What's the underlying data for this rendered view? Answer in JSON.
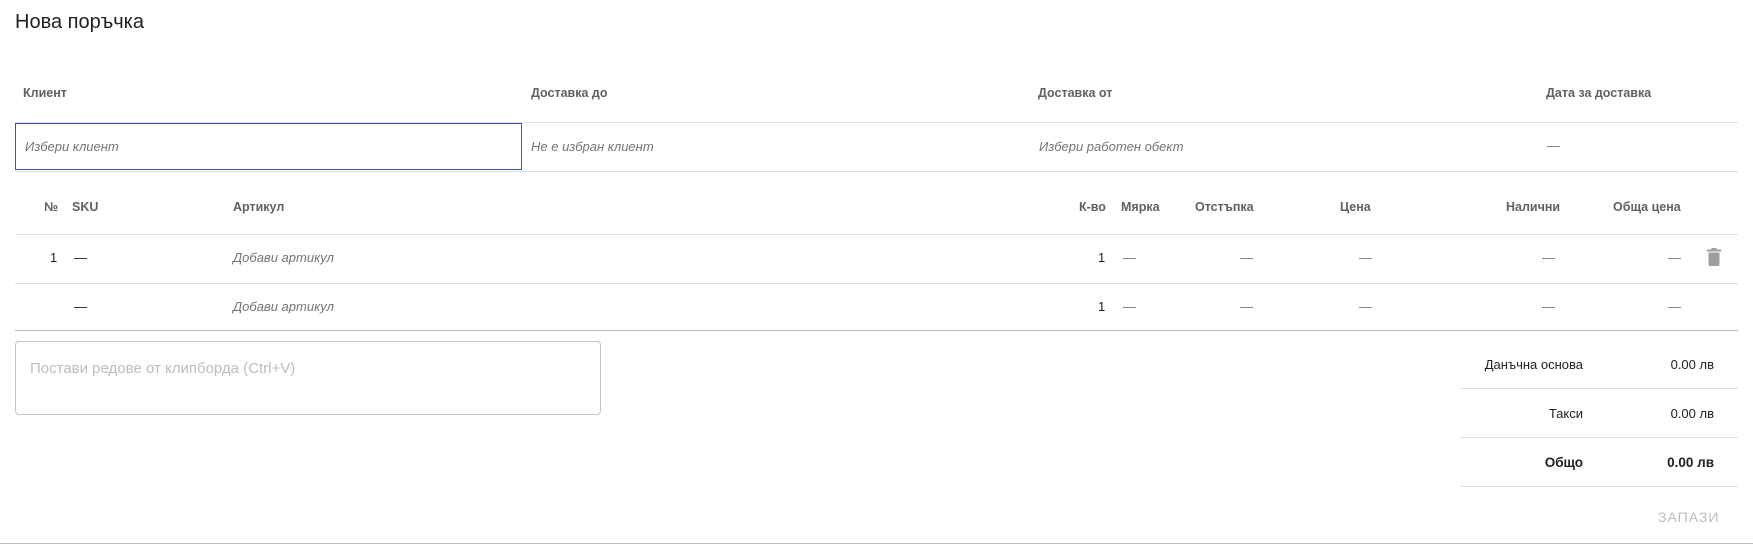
{
  "page": {
    "title": "Нова поръчка"
  },
  "header_table": {
    "columns": {
      "client": "Клиент",
      "delivery_to": "Доставка до",
      "delivery_from": "Доставка от",
      "delivery_date": "Дата за доставка"
    },
    "values": {
      "client_placeholder": "Избери клиент",
      "delivery_to": "Не е избран клиент",
      "delivery_from": "Избери работен обект",
      "delivery_date": "—"
    }
  },
  "items_table": {
    "columns": {
      "number": "№",
      "sku": "SKU",
      "article": "Артикул",
      "quantity": "К-во",
      "unit": "Мярка",
      "discount": "Отстъпка",
      "price": "Цена",
      "available": "Налични",
      "total_price": "Обща цена"
    },
    "rows": [
      {
        "number": "1",
        "sku": "—",
        "article": "Добави артикул",
        "quantity": "1",
        "unit": "—",
        "discount": "—",
        "price": "—",
        "available": "—",
        "total_price": "—",
        "delete_icon": "trash-icon"
      },
      {
        "number": "",
        "sku": "—",
        "article": "Добави артикул",
        "quantity": "1",
        "unit": "—",
        "discount": "—",
        "price": "—",
        "available": "—",
        "total_price": "—"
      }
    ]
  },
  "paste_area": {
    "placeholder": "Постави редове от клипборда (Ctrl+V)"
  },
  "totals": {
    "tax_base_label": "Данъчна основа",
    "tax_base_value": "0.00 лв",
    "taxes_label": "Такси",
    "taxes_value": "0.00 лв",
    "total_label": "Общо",
    "total_value": "0.00 лв"
  },
  "actions": {
    "save_label": "ЗАПАЗИ"
  },
  "colors": {
    "focus_border": "#3f51b5",
    "muted_text": "#757575",
    "disabled_text": "#bdbdbd",
    "divider": "#e0e0e0"
  }
}
